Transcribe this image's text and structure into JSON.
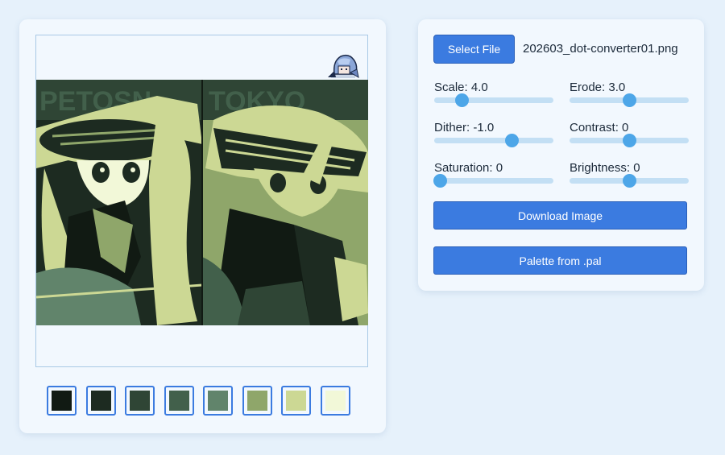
{
  "controls": {
    "select_file_label": "Select File",
    "file_name": "202603_dot-converter01.png",
    "sliders": [
      {
        "id": "scale",
        "label": "Scale: 4.0",
        "value": 4.0,
        "fraction": 0.23
      },
      {
        "id": "erode",
        "label": "Erode: 3.0",
        "value": 3.0,
        "fraction": 0.5
      },
      {
        "id": "dither",
        "label": "Dither: -1.0",
        "value": -1.0,
        "fraction": 0.65
      },
      {
        "id": "contrast",
        "label": "Contrast: 0",
        "value": 0,
        "fraction": 0.5
      },
      {
        "id": "saturation",
        "label": "Saturation: 0",
        "value": 0,
        "fraction": 0.05
      },
      {
        "id": "brightness",
        "label": "Brightness: 0",
        "value": 0,
        "fraction": 0.5
      }
    ],
    "download_label": "Download Image",
    "palette_label": "Palette from .pal"
  },
  "palette": [
    "#111a13",
    "#1d2b21",
    "#2f4535",
    "#42604b",
    "#61846b",
    "#8fa66a",
    "#ccd894",
    "#f2f8d8"
  ],
  "colors": {
    "accent": "#3b7be0",
    "slider_thumb": "#4da6e8",
    "slider_track": "#c3dff4",
    "background": "#e6f1fb"
  }
}
